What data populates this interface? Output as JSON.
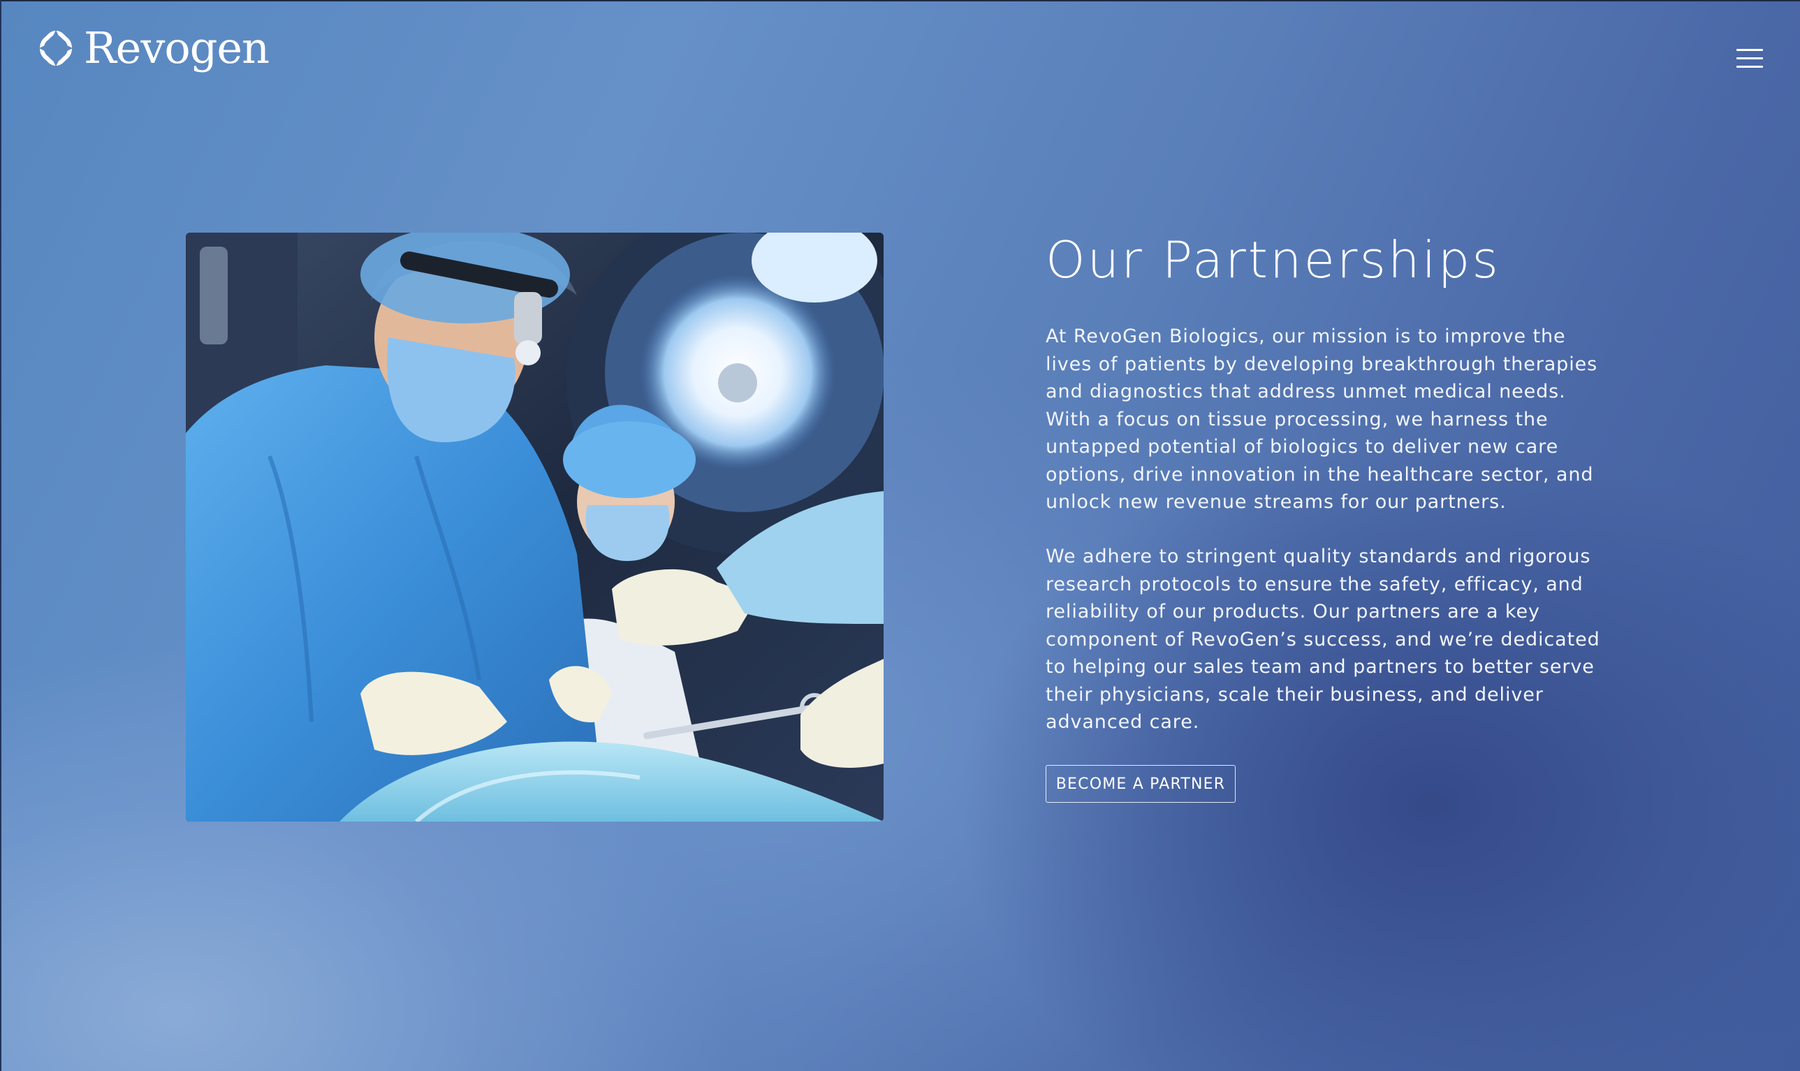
{
  "header": {
    "logo_text": "Revogen",
    "logo_icon": "revogen-ring-logo",
    "menu_icon": "hamburger-menu-icon"
  },
  "hero": {
    "image_alt": "Surgeons in blue scrubs performing an operation under surgical lights"
  },
  "content": {
    "title": "Our Partnerships",
    "paragraph_1": "At RevoGen Biologics, our mission is to improve the lives of patients by developing breakthrough therapies and diagnostics that address unmet medical needs. With a focus on tissue processing, we harness the untapped potential of biologics to deliver new care options, drive innovation in the healthcare sector, and unlock new revenue streams for our partners.",
    "paragraph_2": "We adhere to stringent quality standards and rigorous research protocols to ensure the safety, efficacy, and reliability of our products. Our partners are a key component of RevoGen’s success, and we’re dedicated to helping our sales team and partners to better serve their physicians, scale their business, and deliver advanced care.",
    "cta_label": "BECOME A PARTNER"
  },
  "colors": {
    "background_light": "#6690c8",
    "background_dark": "#3a5290",
    "text": "#ffffff",
    "scrub_blue": "#4a9be0"
  }
}
